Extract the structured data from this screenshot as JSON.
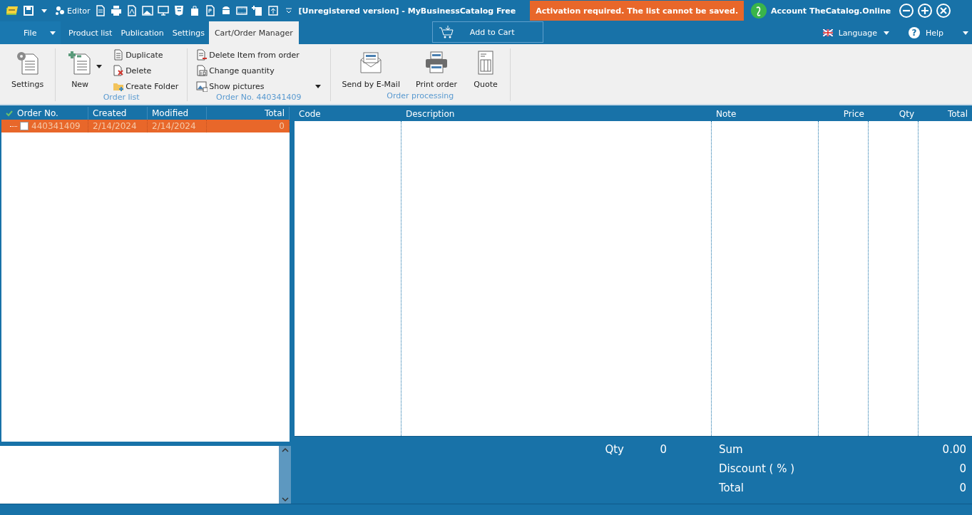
{
  "title_bar": {
    "editor_label": "Editor",
    "title": "[Unregistered version] - MyBusinessCatalog Free",
    "warning": "Activation required. The list cannot be saved.",
    "account": "Account TheCatalog.Online"
  },
  "menu_tabs": [
    {
      "label": "File",
      "selected": false
    },
    {
      "label": "Product list",
      "selected": false
    },
    {
      "label": "Publication",
      "selected": false
    },
    {
      "label": "Settings",
      "selected": false
    },
    {
      "label": "Cart/Order Manager",
      "selected": true
    }
  ],
  "add_to_cart": "Add to Cart",
  "language": "Language",
  "help_icon": "?",
  "help": "Help",
  "ribbon_groups": [
    {
      "items": [
        {
          "kind": "large",
          "label": "Settings"
        }
      ]
    },
    {
      "caption": "Order list",
      "items": [
        {
          "kind": "large",
          "label": "New",
          "dropdown": true
        },
        {
          "kind": "small",
          "label": "Duplicate"
        },
        {
          "kind": "small",
          "label": "Delete"
        },
        {
          "kind": "small",
          "label": "Create Folder"
        }
      ]
    },
    {
      "caption": "Order No. 440341409",
      "items": [
        {
          "kind": "small",
          "label": "Delete Item from order"
        },
        {
          "kind": "small",
          "label": "Change quantity"
        },
        {
          "kind": "small",
          "label": "Show pictures",
          "dropdown": true
        }
      ]
    },
    {
      "caption": "Order processing",
      "items": [
        {
          "kind": "large",
          "label": "Send by E-Mail"
        },
        {
          "kind": "large",
          "label": "Print order"
        },
        {
          "kind": "large",
          "label": "Quote"
        }
      ]
    }
  ],
  "orders_table": {
    "columns": [
      "Order No.",
      "Created",
      "Modified",
      "Total"
    ],
    "rows": [
      {
        "cells": [
          "440341409",
          "2/14/2024",
          "2/14/2024",
          "0"
        ],
        "selected": true,
        "checked": false
      }
    ]
  },
  "items_table": {
    "columns": [
      "Code",
      "Description",
      "Note",
      "Price",
      "Qty",
      "Total"
    ]
  },
  "summary": {
    "qty_label": "Qty",
    "qty": "0",
    "sum_label": "Sum",
    "sum": "0.00",
    "discount_label": "Discount ( % )",
    "discount": "0",
    "total_label": "Total",
    "total": "0"
  }
}
